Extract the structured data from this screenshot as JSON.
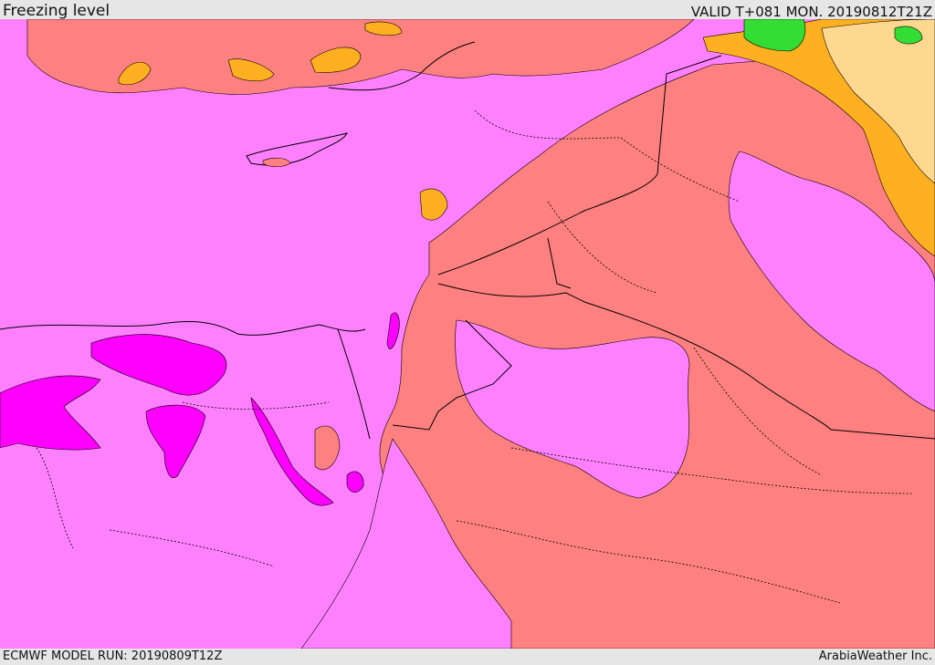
{
  "header": {
    "title": "Freezing level",
    "valid": "VALID T+081 MON. 20190812T21Z"
  },
  "footer": {
    "model_run": "ECMWF MODEL RUN: 20190809T12Z",
    "credit": "ArabiaWeather Inc."
  },
  "map": {
    "colors": {
      "sea": "#ff80ff",
      "band_low": "#ff00ff",
      "band_mid": "#ff8080",
      "band_high": "#ffb020",
      "band_higher": "#ffd890",
      "band_top": "#33dd33",
      "borders": "#000000"
    }
  }
}
